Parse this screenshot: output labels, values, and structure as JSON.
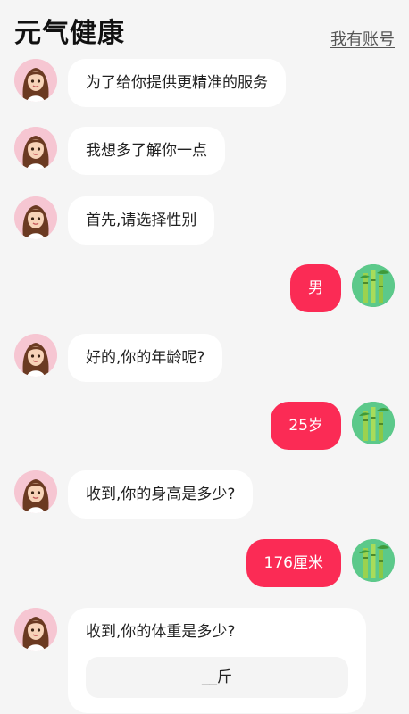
{
  "header": {
    "title": "元气健康",
    "account_link": "我有账号"
  },
  "messages": [
    {
      "from": "bot",
      "text": "为了给你提供更精准的服务"
    },
    {
      "from": "bot",
      "text": "我想多了解你一点"
    },
    {
      "from": "bot",
      "text": "首先,请选择性别"
    },
    {
      "from": "user",
      "text": "男"
    },
    {
      "from": "bot",
      "text": "好的,你的年龄呢?"
    },
    {
      "from": "user",
      "text": "25岁"
    },
    {
      "from": "bot",
      "text": "收到,你的身高是多少?"
    },
    {
      "from": "user",
      "text": "176厘米"
    }
  ],
  "current_question": {
    "text": "收到,你的体重是多少?",
    "answer_placeholder": "__斤"
  },
  "colors": {
    "user_bubble": "#fb2b55",
    "bot_bubble": "#ffffff",
    "background": "#f5f5f5"
  },
  "icons": {
    "bot_avatar": "girl-avatar-icon",
    "user_avatar": "bamboo-avatar-icon"
  }
}
